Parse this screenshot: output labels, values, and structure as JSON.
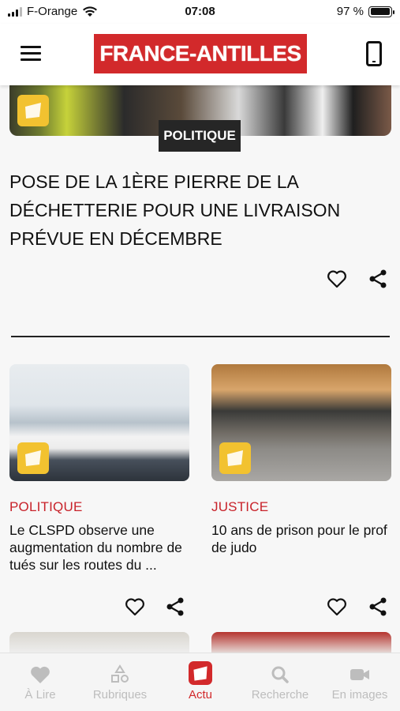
{
  "status_bar": {
    "carrier": "F-Orange",
    "time": "07:08",
    "battery": "97 %",
    "battery_level": 0.97
  },
  "header": {
    "logo_text": "FRANCE-ANTILLES",
    "menu_icon": "hamburger-menu-icon",
    "device_icon": "smartphone-icon",
    "brand_color": "#d2292b"
  },
  "hero": {
    "category": "POLITIQUE",
    "title": " POSE DE LA 1ÈRE PIERRE DE LA DÉCHETTERIE POUR UNE LIVRAISON PRÉVUE EN DÉCEMBRE",
    "badge_icon": "article-badge-icon"
  },
  "cards": [
    {
      "category": "POLITIQUE",
      "title": "Le CLSPD observe une augmentation du nombre de tués sur les routes du ...",
      "image_subject": "meeting-room-photo"
    },
    {
      "category": "JUSTICE",
      "title": "10 ans de prison pour le prof de judo",
      "image_subject": "courtroom-photo"
    }
  ],
  "bottom_nav": {
    "items": [
      {
        "label": "À Lire",
        "icon": "heart-icon",
        "active": false
      },
      {
        "label": "Rubriques",
        "icon": "shapes-icon",
        "active": false
      },
      {
        "label": "Actu",
        "icon": "actu-logo-icon",
        "active": true
      },
      {
        "label": "Recherche",
        "icon": "search-icon",
        "active": false
      },
      {
        "label": "En images",
        "icon": "video-camera-icon",
        "active": false
      }
    ]
  },
  "colors": {
    "category_red": "#c8222a",
    "tag_dark": "#262626",
    "badge_yellow": "#f2c230",
    "nav_inactive": "#bdbdbd"
  }
}
